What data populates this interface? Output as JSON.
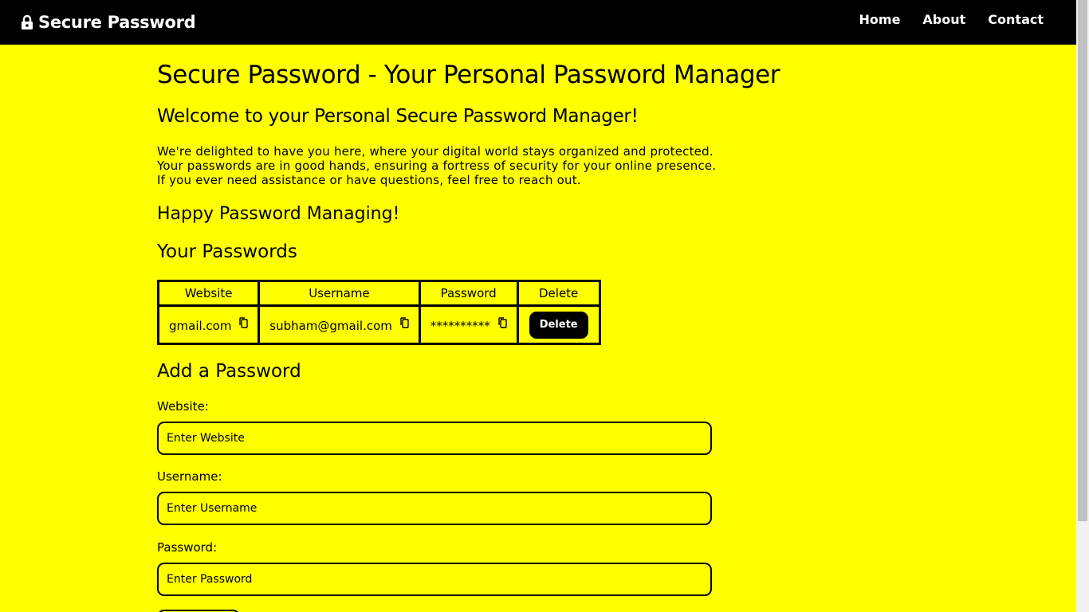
{
  "navbar": {
    "brand": "Secure Password",
    "links": [
      "Home",
      "About",
      "Contact"
    ]
  },
  "main": {
    "title": "Secure Password - Your Personal Password Manager",
    "welcome": "Welcome to your Personal Secure Password Manager!",
    "intro_lines": [
      "We're delighted to have you here, where your digital world stays organized and protected.",
      "Your passwords are in good hands, ensuring a fortress of security for your online presence.",
      "If you ever need assistance or have questions, feel free to reach out."
    ],
    "happy": "Happy Password Managing!",
    "passwords_heading": "Your Passwords",
    "table": {
      "headers": [
        "Website",
        "Username",
        "Password",
        "Delete"
      ],
      "rows": [
        {
          "website": "gmail.com",
          "username": "subham@gmail.com",
          "password": "**********",
          "delete_label": "Delete"
        }
      ]
    },
    "add_heading": "Add a Password",
    "form": {
      "website_label": "Website:",
      "website_placeholder": "Enter Website",
      "username_label": "Username:",
      "username_placeholder": "Enter Username",
      "password_label": "Password:",
      "password_placeholder": "Enter Password"
    }
  },
  "colors": {
    "background": "#ffff00",
    "navbar": "#000000",
    "button": "#000000"
  },
  "icons": {
    "brand": "lock-icon",
    "copy": "copy-icon"
  }
}
